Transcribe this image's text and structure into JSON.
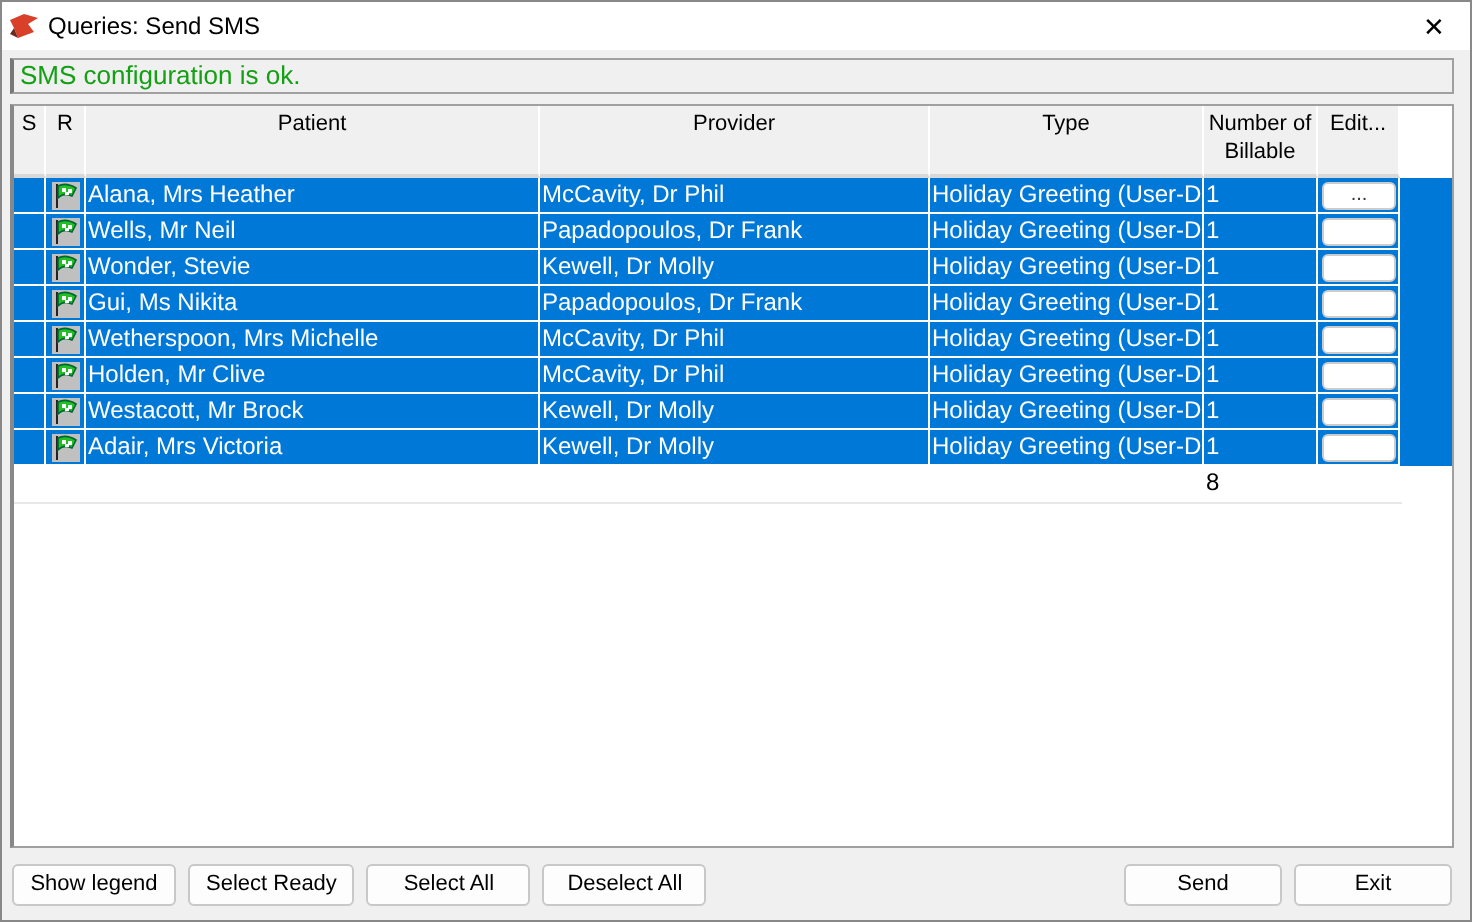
{
  "window": {
    "title": "Queries: Send SMS",
    "close": "✕"
  },
  "status_message": "SMS configuration is ok.",
  "table": {
    "columns": [
      "S",
      "R",
      "Patient",
      "Provider",
      "Type",
      "Number of Billable",
      "Edit..."
    ],
    "rows": [
      {
        "patient": "Alana, Mrs Heather",
        "provider": "McCavity, Dr Phil",
        "type": "Holiday Greeting (User-D",
        "billable": "1",
        "edit_label": "...",
        "selected": true,
        "ready": true
      },
      {
        "patient": "Wells, Mr Neil",
        "provider": "Papadopoulos, Dr Frank",
        "type": "Holiday Greeting (User-D",
        "billable": "1",
        "selected": true,
        "ready": true
      },
      {
        "patient": "Wonder,  Stevie",
        "provider": "Kewell, Dr Molly",
        "type": "Holiday Greeting (User-D",
        "billable": "1",
        "selected": true,
        "ready": true
      },
      {
        "patient": "Gui, Ms Nikita",
        "provider": "Papadopoulos, Dr Frank",
        "type": "Holiday Greeting (User-D",
        "billable": "1",
        "selected": true,
        "ready": true
      },
      {
        "patient": "Wetherspoon, Mrs Michelle",
        "provider": "McCavity, Dr Phil",
        "type": "Holiday Greeting (User-D",
        "billable": "1",
        "selected": true,
        "ready": true
      },
      {
        "patient": "Holden, Mr Clive",
        "provider": "McCavity, Dr Phil",
        "type": "Holiday Greeting (User-D",
        "billable": "1",
        "selected": true,
        "ready": true
      },
      {
        "patient": "Westacott, Mr Brock",
        "provider": "Kewell, Dr Molly",
        "type": "Holiday Greeting (User-D",
        "billable": "1",
        "selected": true,
        "ready": true
      },
      {
        "patient": "Adair, Mrs Victoria",
        "provider": "Kewell, Dr Molly",
        "type": "Holiday Greeting (User-D",
        "billable": "1",
        "selected": true,
        "ready": true
      }
    ],
    "total_billable": "8"
  },
  "left_buttons": [
    "Show legend",
    "Select Ready",
    "Select All",
    "Deselect All"
  ],
  "right_buttons": [
    "Send",
    "Exit"
  ]
}
